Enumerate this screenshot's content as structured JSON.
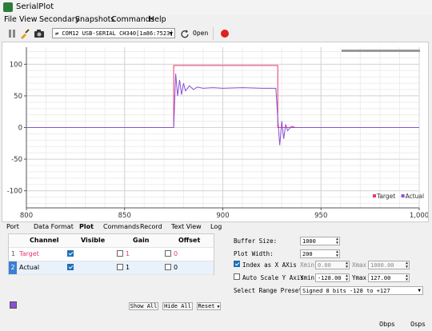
{
  "window": {
    "title": "SerialPlot"
  },
  "menu": [
    {
      "label": "File"
    },
    {
      "label": "View"
    },
    {
      "label": "Secondary"
    },
    {
      "label": "Snapshots"
    },
    {
      "label": "Commands"
    },
    {
      "label": "Help"
    }
  ],
  "toolbar": {
    "port": "⇄ COM12 USB-SERIAL CH340[1a86:7523]",
    "open_label": "Open",
    "icons": [
      "pause-icon",
      "clear-icon",
      "snapshot-icon",
      "refresh-icon",
      "record-icon"
    ],
    "record_color": "#e02020"
  },
  "chart_data": {
    "type": "line",
    "x_ticks": [
      "800",
      "850",
      "900",
      "950",
      "1,000"
    ],
    "y_ticks": [
      "100",
      "50",
      "0",
      "-50",
      "-100"
    ],
    "xlim": [
      800,
      1000
    ],
    "ylim": [
      -127,
      127
    ],
    "grid": true,
    "legend_position": "bottom-right",
    "series": [
      {
        "name": "Target",
        "color": "#e8386e",
        "x": [
          800,
          875,
          875,
          928,
          928,
          1000
        ],
        "y": [
          0,
          0,
          98,
          98,
          0,
          0
        ]
      },
      {
        "name": "Actual",
        "color": "#8a4fd6",
        "x": [
          800,
          875,
          876,
          877,
          878,
          879,
          880,
          881,
          883,
          885,
          887,
          890,
          895,
          900,
          910,
          920,
          926,
          927,
          928,
          929,
          930,
          931,
          932,
          933,
          935,
          937,
          940,
          950,
          1000
        ],
        "y": [
          0,
          0,
          85,
          50,
          75,
          52,
          70,
          58,
          66,
          60,
          64,
          62,
          63,
          62,
          63,
          62,
          62,
          62,
          15,
          -28,
          10,
          -18,
          5,
          -5,
          2,
          0,
          0,
          0,
          0
        ]
      }
    ]
  },
  "tabs": [
    {
      "label": "Port"
    },
    {
      "label": "Data Format"
    },
    {
      "label": "Plot",
      "active": true
    },
    {
      "label": "Commands"
    },
    {
      "label": "Record"
    },
    {
      "label": "Text View"
    },
    {
      "label": "Log"
    }
  ],
  "channels": {
    "headers": {
      "channel": "Channel",
      "visible": "Visible",
      "gain": "Gain",
      "offset": "Offset"
    },
    "rows": [
      {
        "index": "1",
        "name": "Target",
        "visible": true,
        "gain_checked": false,
        "gain": "1",
        "offset_checked": false,
        "offset": "0",
        "color": "#e8386e"
      },
      {
        "index": "2",
        "name": "Actual",
        "visible": true,
        "gain_checked": false,
        "gain": "1",
        "offset_checked": false,
        "offset": "0",
        "color": "#000000"
      }
    ],
    "show_all": "Show All",
    "hide_all": "Hide All",
    "reset": "Reset",
    "swatch_color": "#8a4fd6"
  },
  "plot_settings": {
    "buffer_label": "Buffer Size:",
    "buffer_value": "1000",
    "width_label": "Plot Width:",
    "width_value": "200",
    "index_label": "Index as X AXis",
    "index_checked": true,
    "xmin_label": "Xmin",
    "xmin_value": "0.00",
    "xmax_label": "Xmax",
    "xmax_value": "1000.00",
    "autoscale_label": "Auto Scale Y Axis",
    "autoscale_checked": false,
    "ymin_label": "Ymin",
    "ymin_value": "-128.00",
    "ymax_label": "Ymax",
    "ymax_value": "127.00",
    "range_label": "Select Range Preset:",
    "range_value": "Signed 8 bits -128 to +127"
  },
  "status": {
    "rate1": "0bps",
    "rate2": "0sps"
  }
}
